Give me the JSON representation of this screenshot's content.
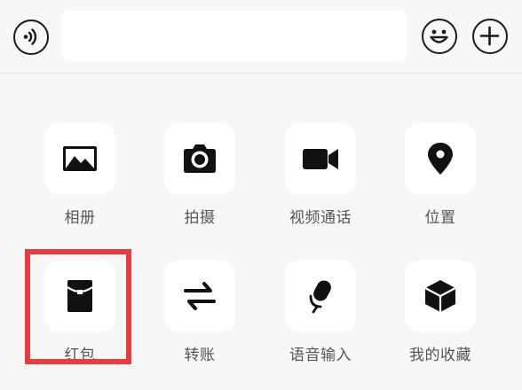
{
  "input_bar": {
    "voice_icon": "voice-wave-icon",
    "input_value": "",
    "emoji_icon": "smiley-icon",
    "plus_icon": "plus-icon"
  },
  "panel": {
    "items": [
      {
        "label": "相册",
        "icon": "image-icon"
      },
      {
        "label": "拍摄",
        "icon": "camera-icon"
      },
      {
        "label": "视频通话",
        "icon": "video-camera-icon"
      },
      {
        "label": "位置",
        "icon": "location-pin-icon"
      },
      {
        "label": "红包",
        "icon": "red-envelope-icon"
      },
      {
        "label": "转账",
        "icon": "transfer-arrows-icon"
      },
      {
        "label": "语音输入",
        "icon": "microphone-icon"
      },
      {
        "label": "我的收藏",
        "icon": "cube-icon"
      }
    ],
    "highlight_color": "#ea3b3f"
  }
}
